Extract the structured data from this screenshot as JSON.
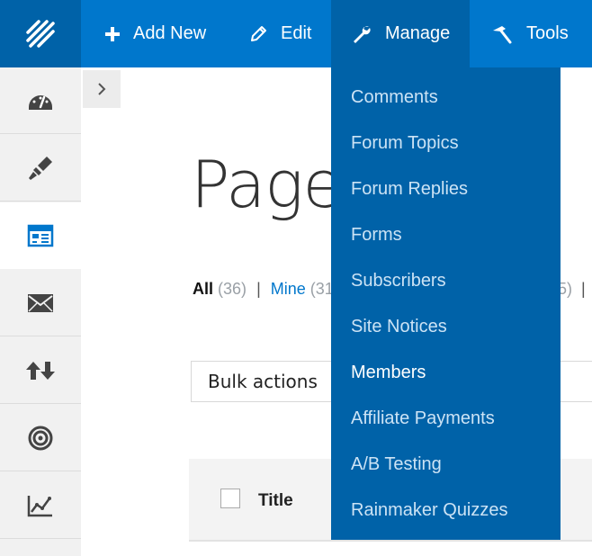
{
  "topbar": {
    "add_new_label": "Add New",
    "edit_label": "Edit",
    "manage_label": "Manage",
    "tools_label": "Tools"
  },
  "sidebar": {
    "items": [
      {
        "icon": "dashboard-icon"
      },
      {
        "icon": "paintbrush-icon"
      },
      {
        "icon": "layout-icon",
        "active": true
      },
      {
        "icon": "mail-icon"
      },
      {
        "icon": "transfer-arrows-icon"
      },
      {
        "icon": "target-icon"
      },
      {
        "icon": "analytics-icon"
      }
    ]
  },
  "main": {
    "title": "Pages",
    "filters": {
      "all_label": "All",
      "all_count": "(36)",
      "mine_label": "Mine",
      "mine_count": "(31",
      "partial_count": "5)",
      "separator": "|"
    },
    "bulk_actions": "Bulk actions",
    "table": {
      "title_header": "Title"
    }
  },
  "manage_menu": {
    "items": [
      "Comments",
      "Forum Topics",
      "Forum Replies",
      "Forms",
      "Subscribers",
      "Site Notices",
      "Members",
      "Affiliate Payments",
      "A/B Testing",
      "Rainmaker Quizzes"
    ],
    "hovered": "Members"
  },
  "colors": {
    "topbar": "#0077cc",
    "topbar_dark": "#0062a8",
    "sidebar_icon_active": "#0077cc",
    "sidebar_icon": "#444444"
  }
}
